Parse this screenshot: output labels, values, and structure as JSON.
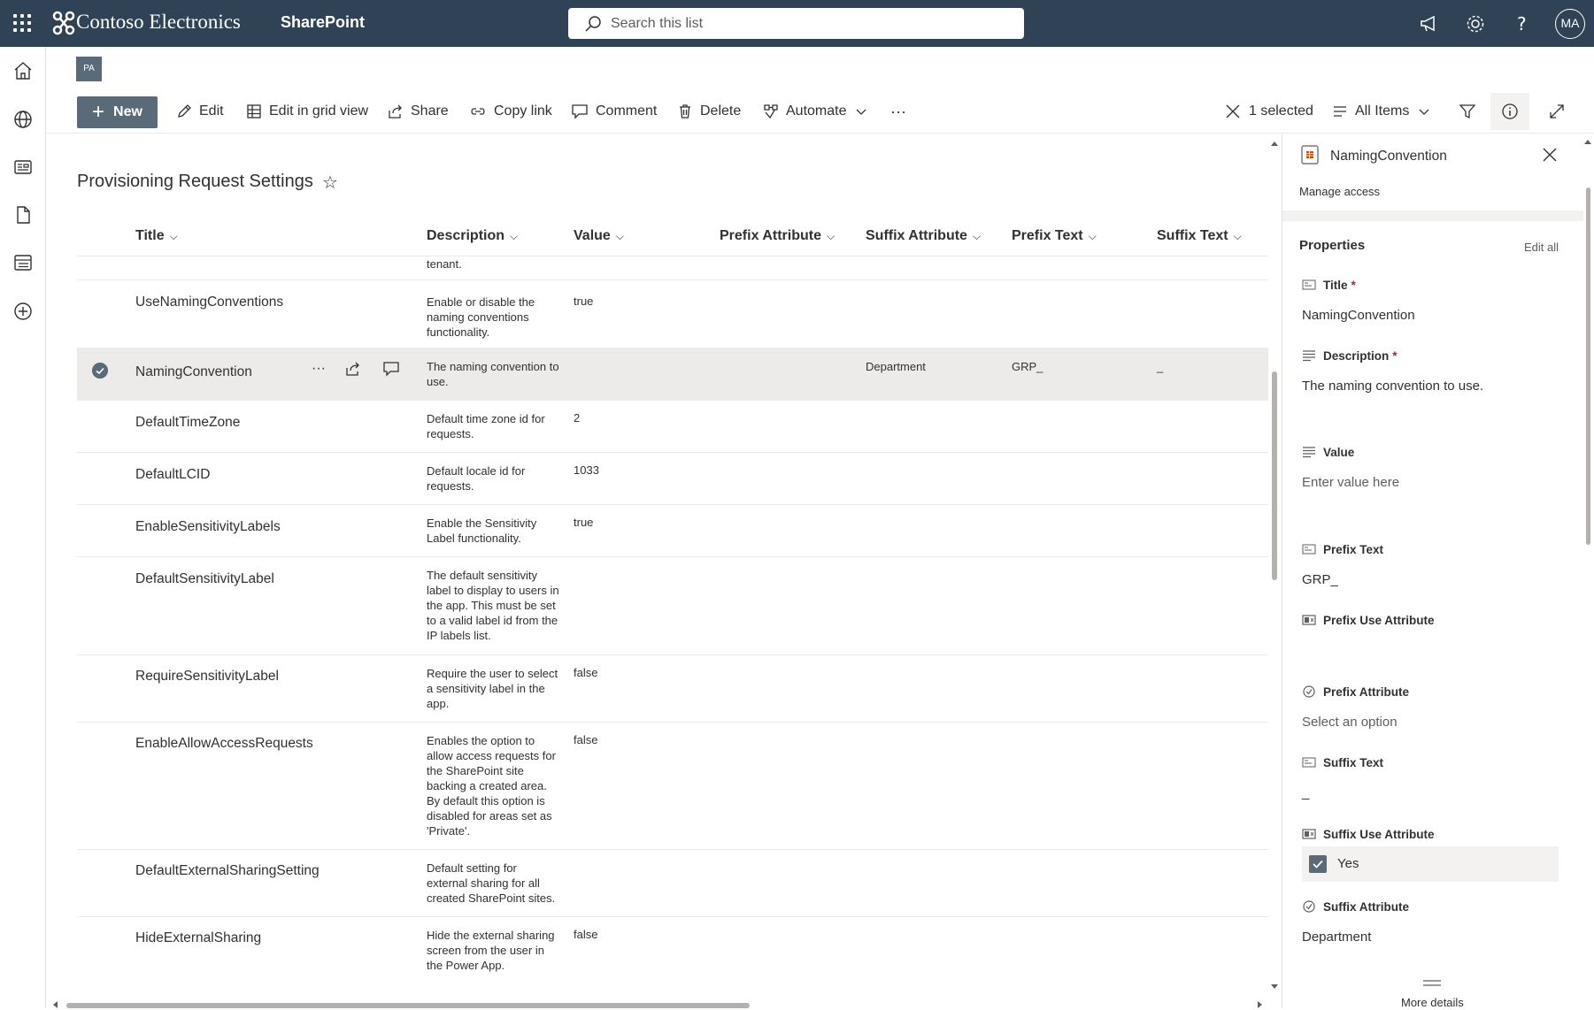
{
  "suite": {
    "brand": "Contoso Electronics",
    "app": "SharePoint",
    "search_placeholder": "Search this list",
    "avatar_initials": "MA"
  },
  "site": {
    "badge": "PA"
  },
  "commandbar": {
    "new": "New",
    "edit": "Edit",
    "edit_grid": "Edit in grid view",
    "share": "Share",
    "copy_link": "Copy link",
    "comment": "Comment",
    "delete": "Delete",
    "automate": "Automate",
    "more": "···",
    "selected": "1 selected",
    "view": "All Items"
  },
  "list": {
    "title": "Provisioning Request Settings",
    "columns": {
      "title": "Title",
      "description": "Description",
      "value": "Value",
      "prefix_attribute": "Prefix Attribute",
      "suffix_attribute": "Suffix Attribute",
      "prefix_text": "Prefix Text",
      "suffix_text": "Suffix Text"
    },
    "partial_row": {
      "description": "tenant."
    },
    "rows": [
      {
        "title": "UseNamingConventions",
        "description": "Enable or disable the naming conventions functionality.",
        "value": "true",
        "suffix_attribute": "",
        "prefix_text": "",
        "suffix_text": ""
      },
      {
        "title": "NamingConvention",
        "description": "The naming convention to use.",
        "value": "",
        "suffix_attribute": "Department",
        "prefix_text": "GRP_",
        "suffix_text": "_"
      },
      {
        "title": "DefaultTimeZone",
        "description": "Default time zone id for requests.",
        "value": "2",
        "suffix_attribute": "",
        "prefix_text": "",
        "suffix_text": ""
      },
      {
        "title": "DefaultLCID",
        "description": "Default locale id for requests.",
        "value": "1033",
        "suffix_attribute": "",
        "prefix_text": "",
        "suffix_text": ""
      },
      {
        "title": "EnableSensitivityLabels",
        "description": "Enable the Sensitivity Label functionality.",
        "value": "true",
        "suffix_attribute": "",
        "prefix_text": "",
        "suffix_text": ""
      },
      {
        "title": "DefaultSensitivityLabel",
        "description": "The default sensitivity label to display to users in the app. This must be set to a valid label id from the IP labels list.",
        "value": "",
        "suffix_attribute": "",
        "prefix_text": "",
        "suffix_text": ""
      },
      {
        "title": "RequireSensitivityLabel",
        "description": "Require the user to select a sensitivity label in the app.",
        "value": "false",
        "suffix_attribute": "",
        "prefix_text": "",
        "suffix_text": ""
      },
      {
        "title": "EnableAllowAccessRequests",
        "description": "Enables the option to allow access requests for the SharePoint site backing a created area. By default this option is disabled for areas set as 'Private'.",
        "value": "false",
        "suffix_attribute": "",
        "prefix_text": "",
        "suffix_text": ""
      },
      {
        "title": "DefaultExternalSharingSetting",
        "description": "Default setting for external sharing for all created SharePoint sites.",
        "value": "",
        "suffix_attribute": "",
        "prefix_text": "",
        "suffix_text": ""
      },
      {
        "title": "HideExternalSharing",
        "description": "Hide the external sharing screen from the user in the Power App.",
        "value": "false",
        "suffix_attribute": "",
        "prefix_text": "",
        "suffix_text": ""
      }
    ]
  },
  "panel": {
    "title": "NamingConvention",
    "manage_access": "Manage access",
    "properties": "Properties",
    "edit_all": "Edit all",
    "fields": {
      "title_label": "Title",
      "title_value": "NamingConvention",
      "description_label": "Description",
      "description_value": "The naming convention to use.",
      "value_label": "Value",
      "value_placeholder": "Enter value here",
      "prefix_text_label": "Prefix Text",
      "prefix_text_value": "GRP_",
      "prefix_use_attr_label": "Prefix Use Attribute",
      "prefix_attr_label": "Prefix Attribute",
      "prefix_attr_placeholder": "Select an option",
      "suffix_text_label": "Suffix Text",
      "suffix_text_value": "_",
      "suffix_use_attr_label": "Suffix Use Attribute",
      "suffix_use_attr_value": "Yes",
      "suffix_attr_label": "Suffix Attribute",
      "suffix_attr_value": "Department"
    },
    "required_mark": "*",
    "more_details": "More details"
  }
}
